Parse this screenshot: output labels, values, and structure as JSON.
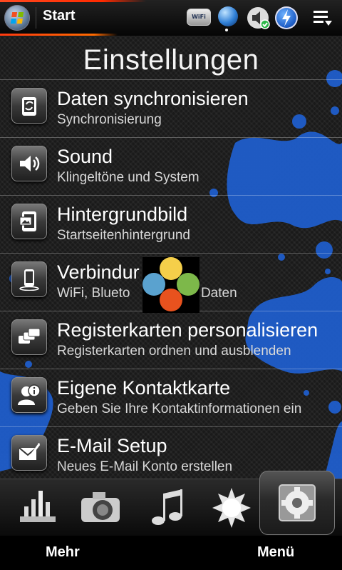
{
  "status_bar": {
    "app_title": "Start",
    "wifi_label": "WiFi"
  },
  "page": {
    "title": "Einstellungen"
  },
  "settings_items": [
    {
      "title": "Daten synchronisieren",
      "subtitle": "Synchronisierung",
      "icon": "sync-icon"
    },
    {
      "title": "Sound",
      "subtitle": "Klingeltöne und System",
      "icon": "speaker-icon"
    },
    {
      "title": "Hintergrundbild",
      "subtitle": "Startseitenhintergrund",
      "icon": "wallpaper-icon"
    },
    {
      "title": "Verbindur",
      "subtitle": "WiFi, Blueto",
      "subtitle_tail": "efon, Daten",
      "icon": "phone-icon"
    },
    {
      "title": "Registerkarten personalisieren",
      "subtitle": "Registerkarten ordnen und ausblenden",
      "icon": "tabs-icon"
    },
    {
      "title": "Eigene Kontaktkarte",
      "subtitle": "Geben Sie Ihre Kontaktinformationen ein",
      "icon": "contact-card-icon"
    },
    {
      "title": "E-Mail Setup",
      "subtitle": "Neues E-Mail Konto erstellen",
      "icon": "email-setup-icon"
    }
  ],
  "tabs": [
    {
      "name": "stocks-tab",
      "icon": "chart-icon"
    },
    {
      "name": "camera-tab",
      "icon": "camera-icon"
    },
    {
      "name": "music-tab",
      "icon": "music-note-icon"
    },
    {
      "name": "weather-tab",
      "icon": "sun-icon"
    },
    {
      "name": "settings-tab",
      "icon": "gear-icon",
      "active": true
    }
  ],
  "softkeys": {
    "left": "Mehr",
    "right": "Menü"
  },
  "colors": {
    "accent": "#ff3a10",
    "splash": "#1f5fd0",
    "background": "#1a1a1a"
  }
}
